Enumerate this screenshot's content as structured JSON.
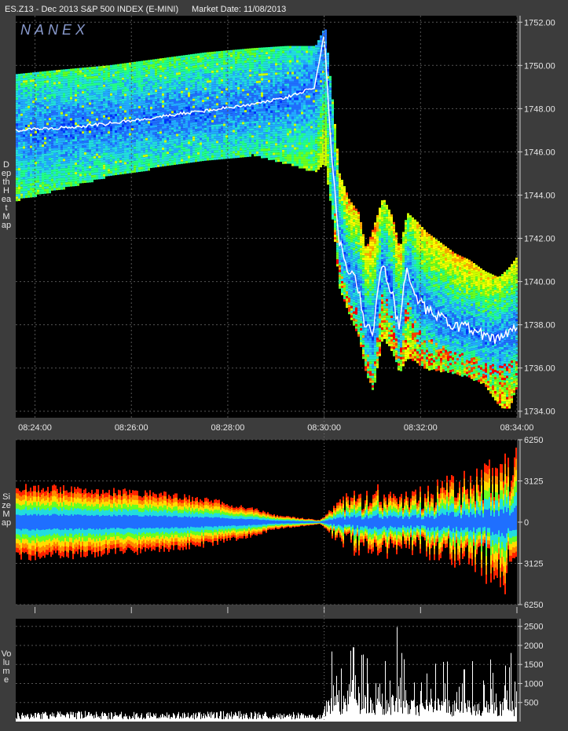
{
  "header": {
    "symbol_title": "ES.Z13 - Dec 2013 S&P 500 INDEX (E-MINI)",
    "market_date": "Market Date: 11/08/2013",
    "watermark": "NANEX"
  },
  "colors": {
    "background": "#3c3c3c",
    "plot_bg": "#000000",
    "grid": "#555555",
    "price_line": "#ffffff",
    "heat_scale": [
      "#0033ff",
      "#1f6fff",
      "#22aaff",
      "#22dddd",
      "#22ff88",
      "#66ff22",
      "#ccff00",
      "#ffff00",
      "#ffaa00",
      "#ff4400",
      "#ff0000"
    ]
  },
  "panels": {
    "depth": {
      "label": "Depth Heat Map"
    },
    "size": {
      "label": "Size Map"
    },
    "volume": {
      "label": "Volume"
    }
  },
  "chart_data": [
    {
      "type": "heatmap",
      "name": "Depth Heat Map",
      "x_ticks": [
        "08:24:00",
        "08:26:00",
        "08:28:00",
        "08:30:00",
        "08:32:00",
        "08:34:00"
      ],
      "y_ticks": [
        "1752.00",
        "1750.00",
        "1748.00",
        "1746.00",
        "1744.00",
        "1742.00",
        "1740.00",
        "1738.00",
        "1736.00",
        "1734.00"
      ],
      "xlim_minutes": [
        23.6,
        34.0
      ],
      "ylim": [
        1733.7,
        1752.3
      ],
      "price_path": [
        [
          23.6,
          1747.0
        ],
        [
          24.5,
          1747.1
        ],
        [
          25.5,
          1747.3
        ],
        [
          26.5,
          1747.6
        ],
        [
          27.5,
          1747.9
        ],
        [
          28.5,
          1748.2
        ],
        [
          29.2,
          1748.5
        ],
        [
          29.8,
          1749.0
        ],
        [
          30.0,
          1751.5
        ],
        [
          30.15,
          1746.0
        ],
        [
          30.3,
          1742.0
        ],
        [
          30.5,
          1740.5
        ],
        [
          30.7,
          1739.8
        ],
        [
          30.85,
          1738.0
        ],
        [
          31.0,
          1737.5
        ],
        [
          31.2,
          1741.0
        ],
        [
          31.4,
          1739.5
        ],
        [
          31.55,
          1737.8
        ],
        [
          31.7,
          1740.5
        ],
        [
          31.9,
          1739.2
        ],
        [
          32.1,
          1738.7
        ],
        [
          32.4,
          1738.3
        ],
        [
          32.7,
          1738.0
        ],
        [
          33.0,
          1737.8
        ],
        [
          33.3,
          1737.5
        ],
        [
          33.6,
          1737.3
        ],
        [
          33.8,
          1737.5
        ],
        [
          34.0,
          1738.0
        ]
      ],
      "band": [
        [
          23.6,
          1743.8,
          1749.6
        ],
        [
          24.5,
          1744.3,
          1749.8
        ],
        [
          25.5,
          1744.9,
          1750.0
        ],
        [
          26.5,
          1745.3,
          1750.3
        ],
        [
          27.5,
          1745.6,
          1750.6
        ],
        [
          28.5,
          1745.9,
          1750.8
        ],
        [
          29.2,
          1745.5,
          1750.9
        ],
        [
          29.8,
          1745.1,
          1750.9
        ],
        [
          30.0,
          1745.5,
          1751.8
        ],
        [
          30.15,
          1743.0,
          1748.5
        ],
        [
          30.3,
          1739.7,
          1745.0
        ],
        [
          30.5,
          1738.5,
          1743.8
        ],
        [
          30.7,
          1737.5,
          1743.2
        ],
        [
          30.85,
          1735.8,
          1741.5
        ],
        [
          31.0,
          1735.0,
          1742.5
        ],
        [
          31.2,
          1737.5,
          1743.9
        ],
        [
          31.4,
          1736.8,
          1743.0
        ],
        [
          31.55,
          1735.8,
          1741.5
        ],
        [
          31.7,
          1736.5,
          1743.2
        ],
        [
          31.9,
          1736.3,
          1742.8
        ],
        [
          32.1,
          1736.0,
          1742.3
        ],
        [
          32.4,
          1735.9,
          1741.8
        ],
        [
          32.7,
          1735.8,
          1741.3
        ],
        [
          33.0,
          1735.6,
          1741.0
        ],
        [
          33.3,
          1735.3,
          1740.5
        ],
        [
          33.6,
          1734.3,
          1740.2
        ],
        [
          33.8,
          1734.1,
          1740.6
        ],
        [
          34.0,
          1735.2,
          1741.2
        ]
      ]
    },
    {
      "type": "area",
      "name": "Size Map",
      "x_ticks": [
        "08:24:00",
        "08:26:00",
        "08:28:00",
        "08:30:00",
        "08:32:00",
        "08:34:00"
      ],
      "y_ticks": [
        "6250",
        "3125",
        "0",
        "3125",
        "6250"
      ],
      "ylim": [
        -6250,
        6250
      ],
      "envelope": [
        [
          23.6,
          2600
        ],
        [
          24.5,
          2500
        ],
        [
          25.5,
          2300
        ],
        [
          26.5,
          2100
        ],
        [
          27.5,
          1700
        ],
        [
          28.5,
          1000
        ],
        [
          29.0,
          500
        ],
        [
          29.5,
          300
        ],
        [
          29.9,
          150
        ],
        [
          30.1,
          800
        ],
        [
          30.5,
          1800
        ],
        [
          31.0,
          2200
        ],
        [
          31.5,
          2100
        ],
        [
          32.0,
          2000
        ],
        [
          32.5,
          2600
        ],
        [
          33.0,
          3000
        ],
        [
          33.5,
          3800
        ],
        [
          34.0,
          4500
        ]
      ]
    },
    {
      "type": "bar",
      "name": "Volume",
      "x_ticks": [
        "08:24:00",
        "08:26:00",
        "08:28:00",
        "08:30:00",
        "08:32:00",
        "08:34:00"
      ],
      "y_ticks": [
        "2500",
        "2000",
        "1500",
        "1000",
        "500"
      ],
      "ylim": [
        0,
        2700
      ],
      "baseline_level": [
        [
          23.6,
          180
        ],
        [
          25.0,
          200
        ],
        [
          26.5,
          180
        ],
        [
          28.0,
          200
        ],
        [
          29.5,
          180
        ],
        [
          29.9,
          130
        ],
        [
          30.0,
          420
        ],
        [
          30.5,
          600
        ],
        [
          31.0,
          560
        ],
        [
          31.5,
          500
        ],
        [
          32.0,
          420
        ],
        [
          32.5,
          450
        ],
        [
          33.0,
          430
        ],
        [
          33.5,
          450
        ],
        [
          34.0,
          420
        ]
      ],
      "spikes": [
        [
          30.15,
          1840
        ],
        [
          30.25,
          1200
        ],
        [
          30.6,
          1950
        ],
        [
          30.9,
          1000
        ],
        [
          31.15,
          1000
        ],
        [
          31.5,
          2480
        ],
        [
          31.6,
          1800
        ],
        [
          32.3,
          1520
        ],
        [
          32.5,
          1000
        ],
        [
          32.9,
          1370
        ],
        [
          33.3,
          1080
        ],
        [
          33.5,
          1280
        ],
        [
          33.75,
          1470
        ],
        [
          33.87,
          1800
        ],
        [
          33.95,
          1050
        ]
      ]
    }
  ]
}
